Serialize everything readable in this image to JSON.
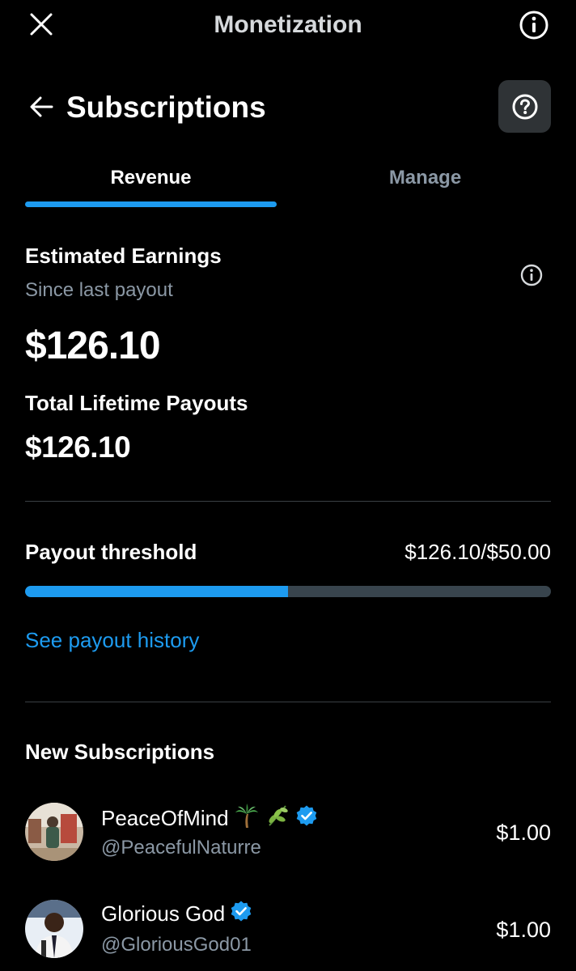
{
  "header": {
    "title": "Monetization",
    "close_icon": "close-icon",
    "info_icon": "info-icon"
  },
  "subheader": {
    "title": "Subscriptions",
    "back_icon": "back-arrow-icon",
    "help_icon": "question-circle-icon"
  },
  "tabs": [
    {
      "label": "Revenue",
      "active": true
    },
    {
      "label": "Manage",
      "active": false
    }
  ],
  "earnings": {
    "heading": "Estimated Earnings",
    "subtitle": "Since last payout",
    "amount": "$126.10",
    "lifetime_heading": "Total Lifetime Payouts",
    "lifetime_amount": "$126.10"
  },
  "threshold": {
    "heading": "Payout threshold",
    "value_text": "$126.10/$50.00",
    "progress_fraction": 0.5
  },
  "history_link": "See payout history",
  "new_subscriptions": {
    "heading": "New Subscriptions",
    "items": [
      {
        "name": "PeaceOfMind",
        "handle": "@PeacefulNaturre",
        "amount": "$1.00",
        "verified": true
      },
      {
        "name": "Glorious God",
        "handle": "@GloriousGod01",
        "amount": "$1.00",
        "verified": true
      }
    ]
  },
  "colors": {
    "background": "#000000",
    "accent": "#1d9bf0",
    "muted_text": "#8b98a5",
    "divider": "#3a3f44",
    "progress_track": "#38444d"
  }
}
